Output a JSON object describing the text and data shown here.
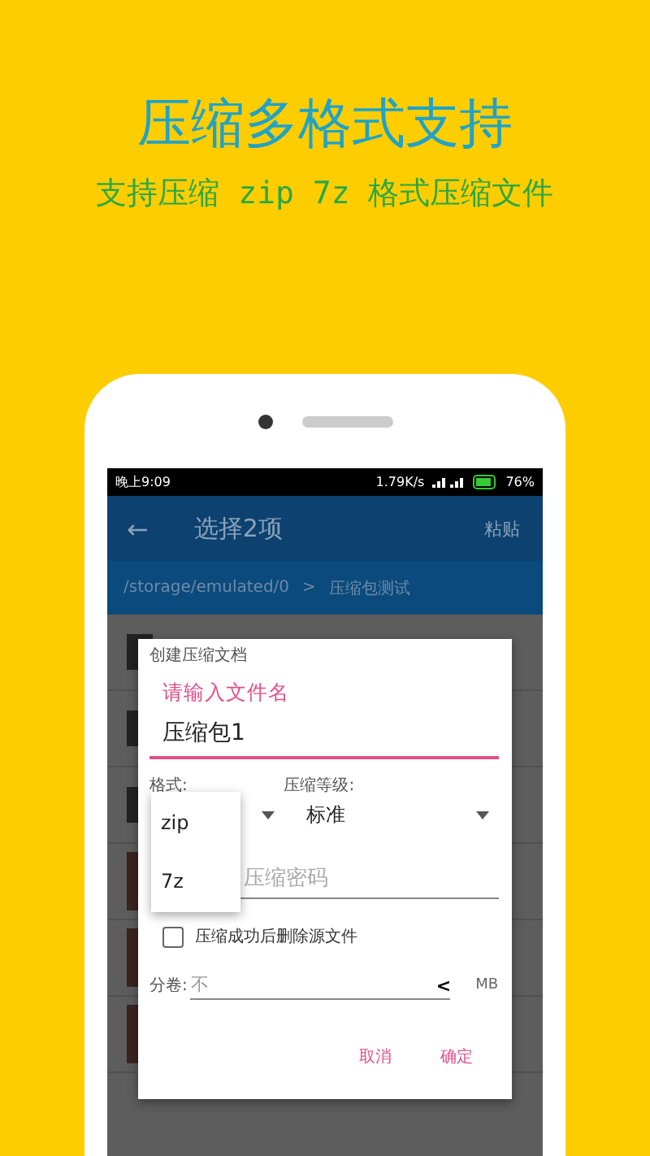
{
  "headline": {
    "title": "压缩多格式支持",
    "subtitle": "支持压缩 zip 7z 格式压缩文件"
  },
  "status_bar": {
    "time": "晚上9:09",
    "speed": "1.79K/s",
    "battery": "76%"
  },
  "app_bar": {
    "back": "←",
    "title": "选择2项",
    "action": "粘贴"
  },
  "breadcrumb": {
    "path": "/storage/emulated/0",
    "separator": ">",
    "folder": "压缩包测试"
  },
  "dialog": {
    "title": "创建压缩文档",
    "name_field": {
      "label": "请输入文件名",
      "value": "压缩包1"
    },
    "format": {
      "label": "格式:"
    },
    "level": {
      "label": "压缩等级:",
      "value": "标准"
    },
    "password": {
      "placeholder": "压缩密码"
    },
    "delete_source": {
      "label": "压缩成功后删除源文件",
      "checked": false
    },
    "split": {
      "label": "分卷:",
      "placeholder": "不",
      "arrow": "<",
      "unit": "MB"
    },
    "buttons": [
      "取消",
      "确定"
    ]
  },
  "format_menu": [
    "zip",
    "7z"
  ]
}
